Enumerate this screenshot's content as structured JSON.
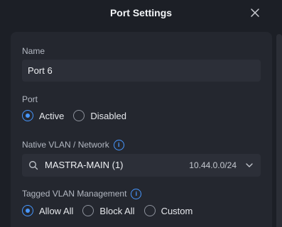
{
  "header": {
    "title": "Port Settings",
    "close_icon": "close-icon"
  },
  "name_section": {
    "label": "Name",
    "value": "Port 6"
  },
  "port_section": {
    "label": "Port",
    "options": [
      {
        "label": "Active",
        "selected": true
      },
      {
        "label": "Disabled",
        "selected": false
      }
    ]
  },
  "native_vlan": {
    "label": "Native VLAN / Network",
    "info_icon": "info-icon",
    "selected_network": "MASTRA-MAIN (1)",
    "subnet": "10.44.0.0/24",
    "search_icon": "search-icon",
    "chevron_icon": "chevron-down-icon"
  },
  "tagged_vlan": {
    "label": "Tagged VLAN Management",
    "info_icon": "info-icon",
    "options": [
      {
        "label": "Allow All",
        "selected": true
      },
      {
        "label": "Block All",
        "selected": false
      },
      {
        "label": "Custom",
        "selected": false
      }
    ]
  },
  "colors": {
    "accent": "#4797ff",
    "background": "#1c1f26",
    "card": "#24272f",
    "input": "#2c2f38"
  }
}
